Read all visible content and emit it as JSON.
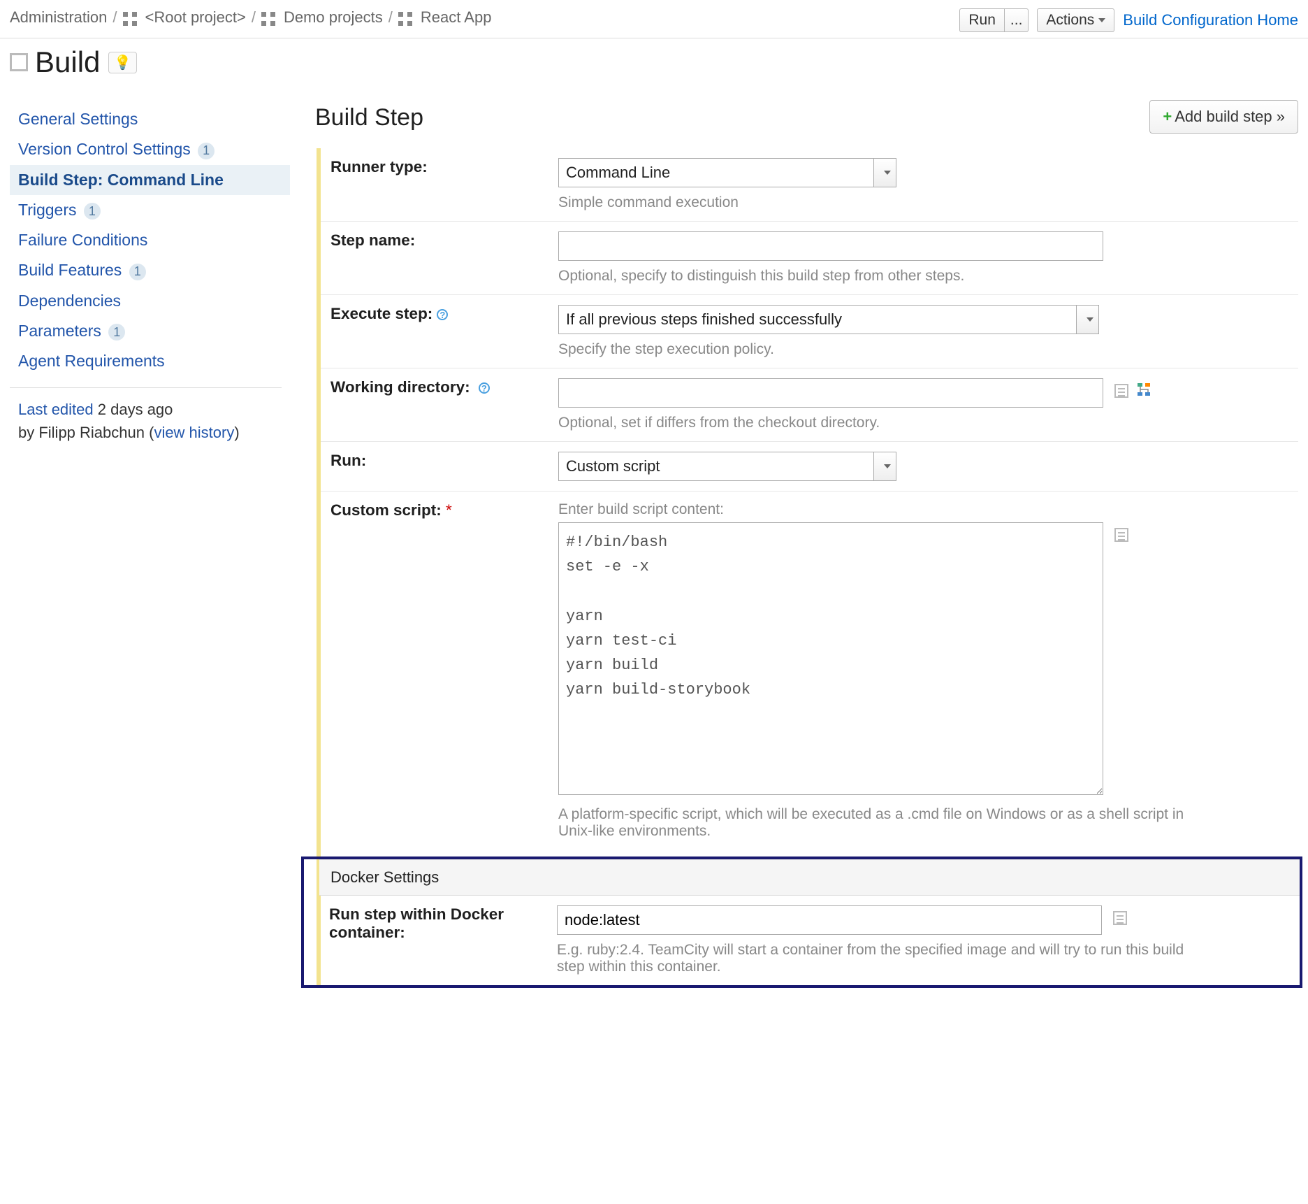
{
  "breadcrumbs": {
    "admin": "Administration",
    "root": "<Root project>",
    "demo": "Demo projects",
    "app": "React App"
  },
  "header": {
    "run": "Run",
    "dots": "...",
    "actions": "Actions",
    "home": "Build Configuration Home"
  },
  "title": "Build",
  "hint_icon": "💡",
  "sidebar": {
    "general": "General Settings",
    "vcs": "Version Control Settings",
    "vcs_count": "1",
    "buildstep": "Build Step: Command Line",
    "triggers": "Triggers",
    "triggers_count": "1",
    "failure": "Failure Conditions",
    "features": "Build Features",
    "features_count": "1",
    "deps": "Dependencies",
    "params": "Parameters",
    "params_count": "1",
    "agents": "Agent Requirements",
    "lastedit": "Last edited",
    "lastedit_time": "2 days ago",
    "by": "by Filipp Riabchun  (",
    "history": "view history",
    "close": ")"
  },
  "main": {
    "heading": "Build Step",
    "add": "Add build step »"
  },
  "form": {
    "runner_type_label": "Runner type:",
    "runner_type_value": "Command Line",
    "runner_type_hint": "Simple command execution",
    "step_name_label": "Step name:",
    "step_name_value": "",
    "step_name_hint": "Optional, specify to distinguish this build step from other steps.",
    "execute_label": "Execute step:",
    "execute_value": "If all previous steps finished successfully",
    "execute_hint": "Specify the step execution policy.",
    "workdir_label": "Working directory:",
    "workdir_value": "",
    "workdir_hint": "Optional, set if differs from the checkout directory.",
    "run_label": "Run:",
    "run_value": "Custom script",
    "script_label": "Custom script:",
    "script_prompt": "Enter build script content:",
    "script_value": "#!/bin/bash\nset -e -x\n\nyarn\nyarn test-ci\nyarn build\nyarn build-storybook",
    "script_hint": "A platform-specific script, which will be executed as a .cmd file on Windows or as a shell script in Unix-like environments.",
    "docker_section": "Docker Settings",
    "docker_label": "Run step within Docker container:",
    "docker_value": "node:latest",
    "docker_hint": "E.g. ruby:2.4. TeamCity will start a container from the specified image and will try to run this build step within this container."
  }
}
